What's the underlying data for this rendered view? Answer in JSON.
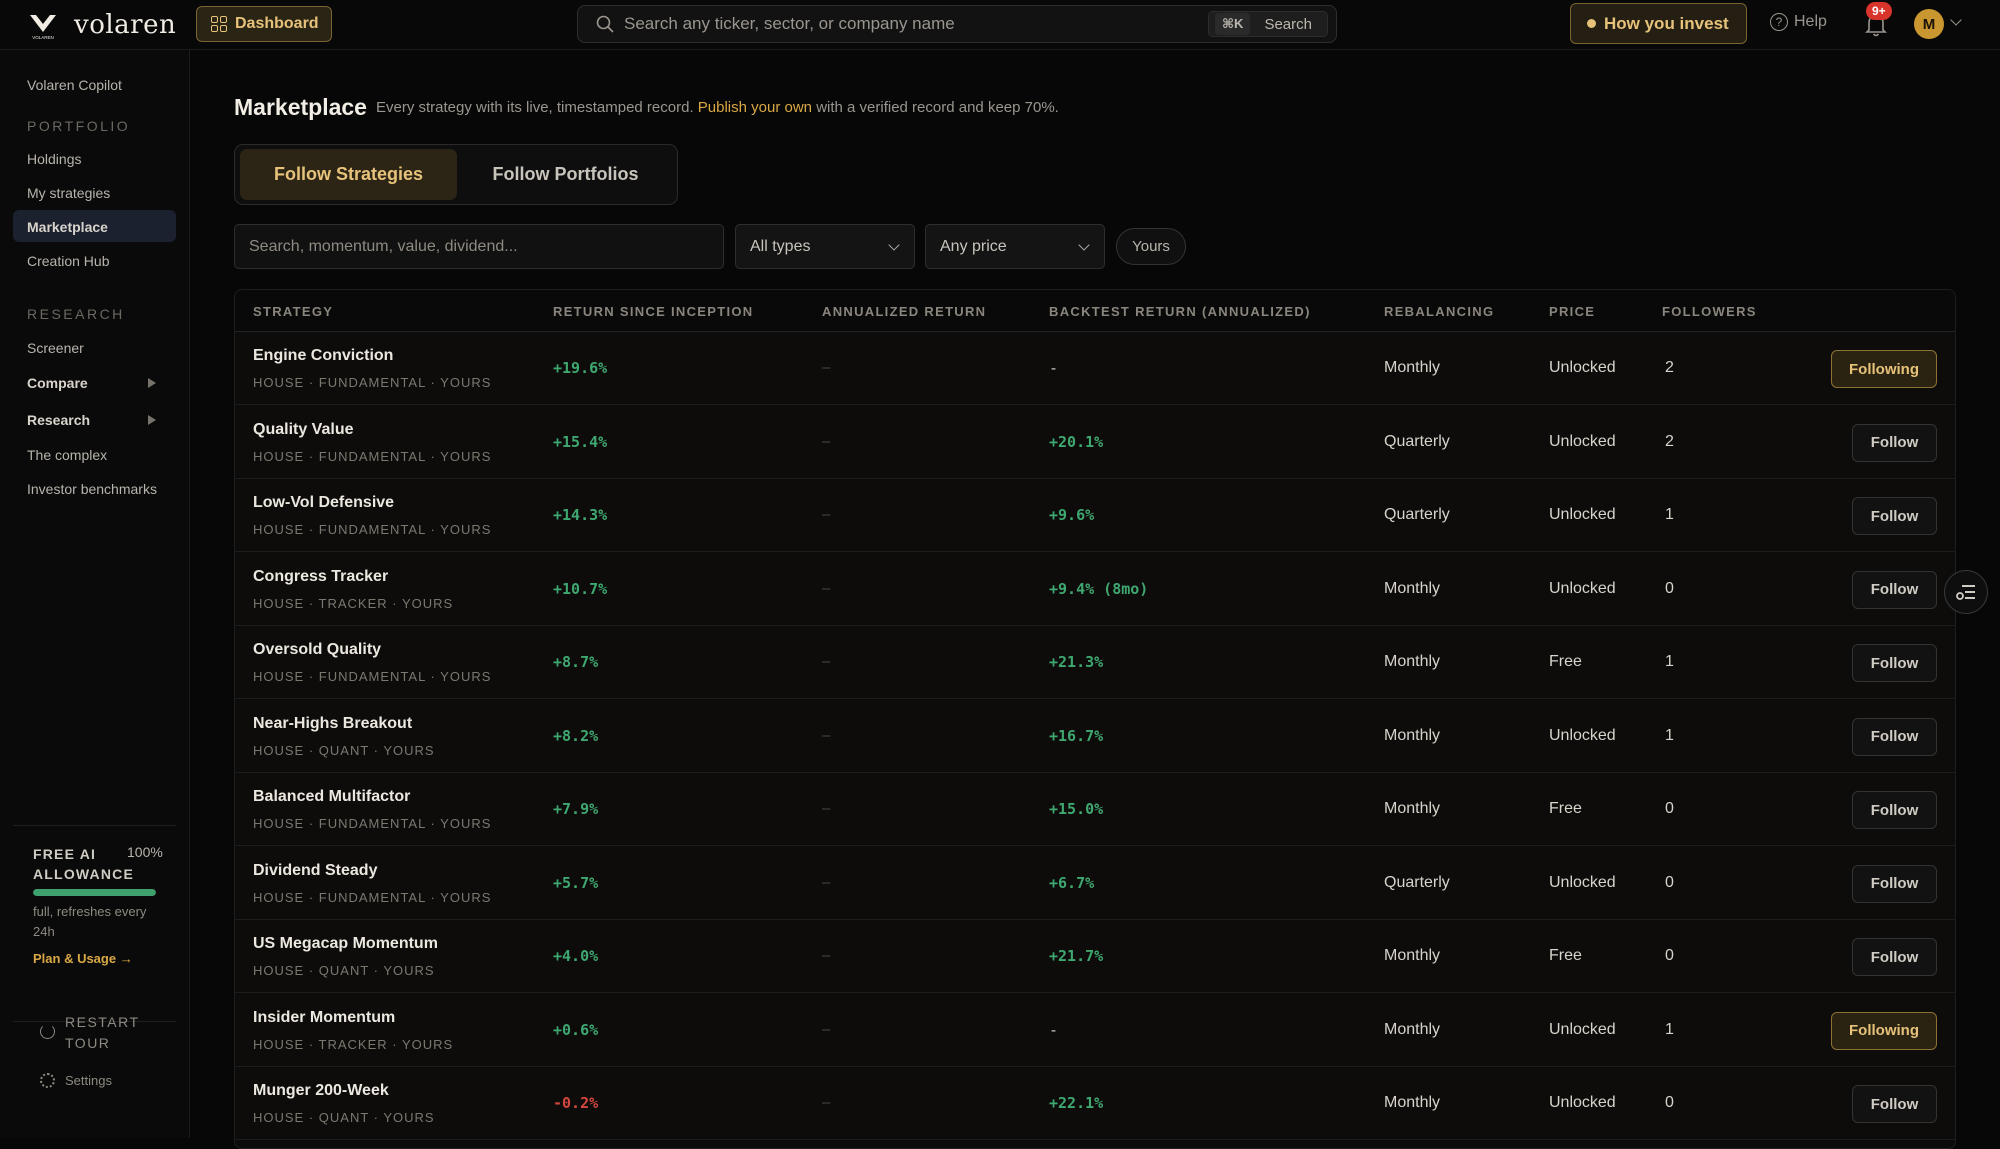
{
  "app": {
    "name": "volaren",
    "logo_caption": "VOLAREN",
    "dashboard_label": "Dashboard",
    "search_placeholder": "Search any ticker, sector, or company name",
    "search_shortcut": "⌘K",
    "search_button": "Search",
    "how_invest_label": "How you invest",
    "help_label": "Help",
    "notification_badge": "9+",
    "avatar_initial": "M"
  },
  "sidebar": {
    "copilot": "Volaren Copilot",
    "portfolio_heading": "PORTFOLIO",
    "portfolio_items": [
      "Holdings",
      "My strategies",
      "Marketplace",
      "Creation Hub"
    ],
    "research_heading": "RESEARCH",
    "research_items": [
      "Screener",
      "Compare",
      "Research",
      "The complex",
      "Investor benchmarks"
    ],
    "allowance": {
      "title": "FREE AI ALLOWANCE",
      "percent": "100%",
      "fill_fraction": 1.0,
      "note": "full, refreshes every 24h",
      "link": "Plan & Usage →"
    },
    "restart_tour": "RESTART TOUR",
    "settings": "Settings"
  },
  "main": {
    "title": "Marketplace",
    "subtitle_prefix": "Every strategy with its live, timestamped record.",
    "subtitle_link": "Publish your own",
    "subtitle_suffix": "with a verified record and keep 70%.",
    "tabs": [
      "Follow Strategies",
      "Follow Portfolios"
    ],
    "filter_placeholder": "Search, momentum, value, dividend...",
    "type_select": "All types",
    "price_select": "Any price",
    "yours_pill": "Yours"
  },
  "table": {
    "columns": [
      "STRATEGY",
      "RETURN SINCE INCEPTION",
      "ANNUALIZED RETURN",
      "BACKTEST RETURN (ANNUALIZED)",
      "REBALANCING",
      "PRICE",
      "FOLLOWERS"
    ],
    "rows": [
      {
        "name": "Engine Conviction",
        "tags": "HOUSE · FUNDAMENTAL · YOURS",
        "return": "+19.6%",
        "annualized": "–",
        "backtest": "-",
        "rebalancing": "Monthly",
        "price": "Unlocked",
        "followers": "2",
        "action": "Following"
      },
      {
        "name": "Quality Value",
        "tags": "HOUSE · FUNDAMENTAL · YOURS",
        "return": "+15.4%",
        "annualized": "–",
        "backtest": "+20.1%",
        "rebalancing": "Quarterly",
        "price": "Unlocked",
        "followers": "2",
        "action": "Follow"
      },
      {
        "name": "Low-Vol Defensive",
        "tags": "HOUSE · FUNDAMENTAL · YOURS",
        "return": "+14.3%",
        "annualized": "–",
        "backtest": "+9.6%",
        "rebalancing": "Quarterly",
        "price": "Unlocked",
        "followers": "1",
        "action": "Follow"
      },
      {
        "name": "Congress Tracker",
        "tags": "HOUSE · TRACKER · YOURS",
        "return": "+10.7%",
        "annualized": "–",
        "backtest": "+9.4% (8mo)",
        "rebalancing": "Monthly",
        "price": "Unlocked",
        "followers": "0",
        "action": "Follow"
      },
      {
        "name": "Oversold Quality",
        "tags": "HOUSE · FUNDAMENTAL · YOURS",
        "return": "+8.7%",
        "annualized": "–",
        "backtest": "+21.3%",
        "rebalancing": "Monthly",
        "price": "Free",
        "followers": "1",
        "action": "Follow"
      },
      {
        "name": "Near-Highs Breakout",
        "tags": "HOUSE · QUANT · YOURS",
        "return": "+8.2%",
        "annualized": "–",
        "backtest": "+16.7%",
        "rebalancing": "Monthly",
        "price": "Unlocked",
        "followers": "1",
        "action": "Follow"
      },
      {
        "name": "Balanced Multifactor",
        "tags": "HOUSE · FUNDAMENTAL · YOURS",
        "return": "+7.9%",
        "annualized": "–",
        "backtest": "+15.0%",
        "rebalancing": "Monthly",
        "price": "Free",
        "followers": "0",
        "action": "Follow"
      },
      {
        "name": "Dividend Steady",
        "tags": "HOUSE · FUNDAMENTAL · YOURS",
        "return": "+5.7%",
        "annualized": "–",
        "backtest": "+6.7%",
        "rebalancing": "Quarterly",
        "price": "Unlocked",
        "followers": "0",
        "action": "Follow"
      },
      {
        "name": "US Megacap Momentum",
        "tags": "HOUSE · QUANT · YOURS",
        "return": "+4.0%",
        "annualized": "–",
        "backtest": "+21.7%",
        "rebalancing": "Monthly",
        "price": "Free",
        "followers": "0",
        "action": "Follow"
      },
      {
        "name": "Insider Momentum",
        "tags": "HOUSE · TRACKER · YOURS",
        "return": "+0.6%",
        "annualized": "–",
        "backtest": "-",
        "rebalancing": "Monthly",
        "price": "Unlocked",
        "followers": "1",
        "action": "Following"
      },
      {
        "name": "Munger 200-Week",
        "tags": "HOUSE · QUANT · YOURS",
        "return": "-0.2%",
        "annualized": "–",
        "backtest": "+22.1%",
        "rebalancing": "Monthly",
        "price": "Unlocked",
        "followers": "0",
        "action": "Follow"
      }
    ]
  },
  "colors": {
    "accent_gold": "#e6c27a",
    "positive": "#3fa870",
    "negative": "#d4473e",
    "background": "#070707"
  }
}
